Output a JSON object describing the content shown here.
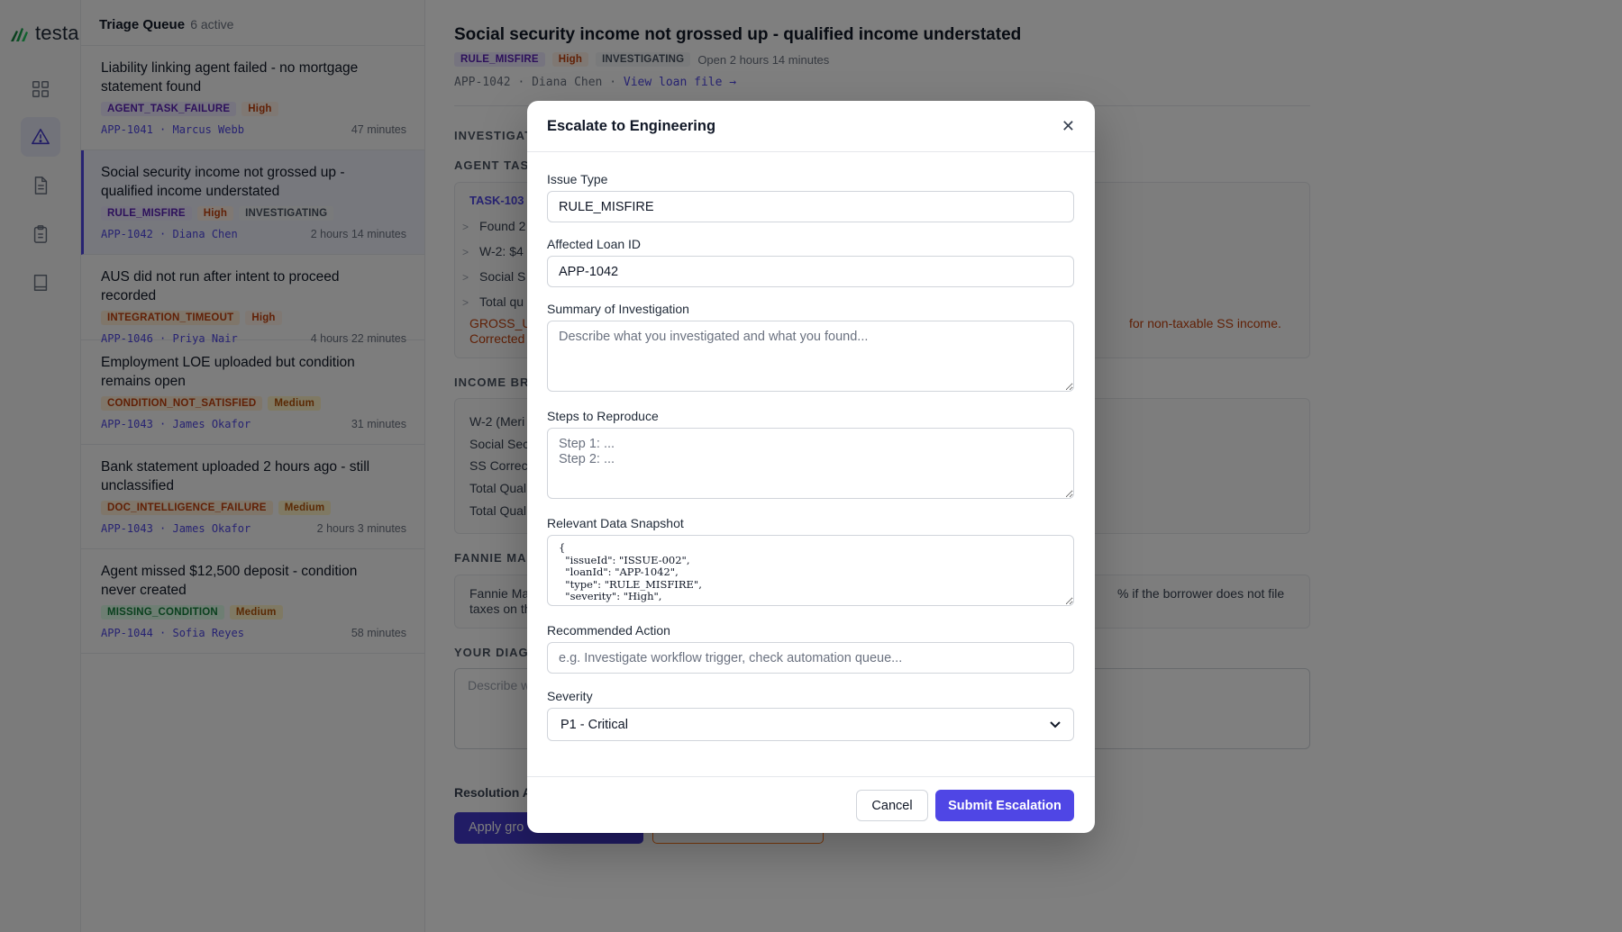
{
  "brand": {
    "name": "testa"
  },
  "nav": {
    "items": [
      {
        "icon": "grid-icon"
      },
      {
        "icon": "alert-triangle-icon",
        "active": true
      },
      {
        "icon": "document-icon"
      },
      {
        "icon": "clipboard-icon"
      },
      {
        "icon": "book-icon"
      }
    ]
  },
  "queue": {
    "title": "Triage Queue",
    "count": "6 active",
    "items": [
      {
        "title": "Liability linking agent failed - no mortgage statement found",
        "tags": [
          "AGENT_TASK_FAILURE",
          "High"
        ],
        "loan": "APP-1041",
        "borrower": "Marcus Webb",
        "age": "47 minutes"
      },
      {
        "title": "Social security income not grossed up - qualified income understated",
        "tags": [
          "RULE_MISFIRE",
          "High",
          "INVESTIGATING"
        ],
        "loan": "APP-1042",
        "borrower": "Diana Chen",
        "age": "2 hours 14 minutes"
      },
      {
        "title": "AUS did not run after intent to proceed recorded",
        "tags": [
          "INTEGRATION_TIMEOUT",
          "High"
        ],
        "loan": "APP-1046",
        "borrower": "Priya Nair",
        "age": "4 hours 22 minutes"
      },
      {
        "title": "Employment LOE uploaded but condition remains open",
        "tags": [
          "CONDITION_NOT_SATISFIED",
          "Medium"
        ],
        "loan": "APP-1043",
        "borrower": "James Okafor",
        "age": "31 minutes"
      },
      {
        "title": "Bank statement uploaded 2 hours ago - still unclassified",
        "tags": [
          "DOC_INTELLIGENCE_FAILURE",
          "Medium"
        ],
        "loan": "APP-1043",
        "borrower": "James Okafor",
        "age": "2 hours 3 minutes"
      },
      {
        "title": "Agent missed $12,500 deposit - condition never created",
        "tags": [
          "MISSING_CONDITION",
          "Medium"
        ],
        "loan": "APP-1044",
        "borrower": "Sofia Reyes",
        "age": "58 minutes"
      }
    ]
  },
  "detail": {
    "title": "Social security income not grossed up - qualified income understated",
    "tags": [
      "RULE_MISFIRE",
      "High",
      "INVESTIGATING"
    ],
    "open_for": "Open 2 hours 14 minutes",
    "loan": "APP-1042",
    "borrower": "Diana Chen",
    "view_link": "View loan file →",
    "sections": {
      "investigation": "INVESTIGAT",
      "agent_task": "AGENT TASK",
      "income": "INCOME BRE",
      "fannie": "FANNIE MAE",
      "diagnosis": "YOUR DIAGN"
    },
    "task_id": "TASK-103",
    "task_rows": [
      "Found 2",
      "W-2: $4",
      "Social S",
      "Total qu"
    ],
    "warning_left": "GROSS_U",
    "warning_left2": "Corrected",
    "warning_right": "for non-taxable SS income.",
    "income_rows": [
      "W-2 (Meri",
      "Social Sec",
      "SS Correct",
      "Total Qual",
      "Total Qual"
    ],
    "fannie_left": "Fannie Ma",
    "fannie_left2": "taxes on th",
    "fannie_right": "% if the borrower does not file",
    "diagnosis_placeholder": "Describe w",
    "resolution_label": "Resolution A",
    "apply_button": "Apply gro"
  },
  "modal": {
    "title": "Escalate to Engineering",
    "issue_type_label": "Issue Type",
    "issue_type_value": "RULE_MISFIRE",
    "loan_id_label": "Affected Loan ID",
    "loan_id_value": "APP-1042",
    "summary_label": "Summary of Investigation",
    "summary_placeholder": "Describe what you investigated and what you found...",
    "steps_label": "Steps to Reproduce",
    "steps_placeholder": "Step 1: ...\nStep 2: ...",
    "snapshot_label": "Relevant Data Snapshot",
    "snapshot_value": "{\n  \"issueId\": \"ISSUE-002\",\n  \"loanId\": \"APP-1042\",\n  \"type\": \"RULE_MISFIRE\",\n  \"severity\": \"High\",",
    "action_label": "Recommended Action",
    "action_placeholder": "e.g. Investigate workflow trigger, check automation queue...",
    "severity_label": "Severity",
    "severity_value": "P1 - Critical",
    "cancel": "Cancel",
    "submit": "Submit Escalation"
  },
  "colors": {
    "accent": "#4f46e5",
    "warning": "#c2410c",
    "overlay": "rgba(0,0,0,0.5)"
  }
}
